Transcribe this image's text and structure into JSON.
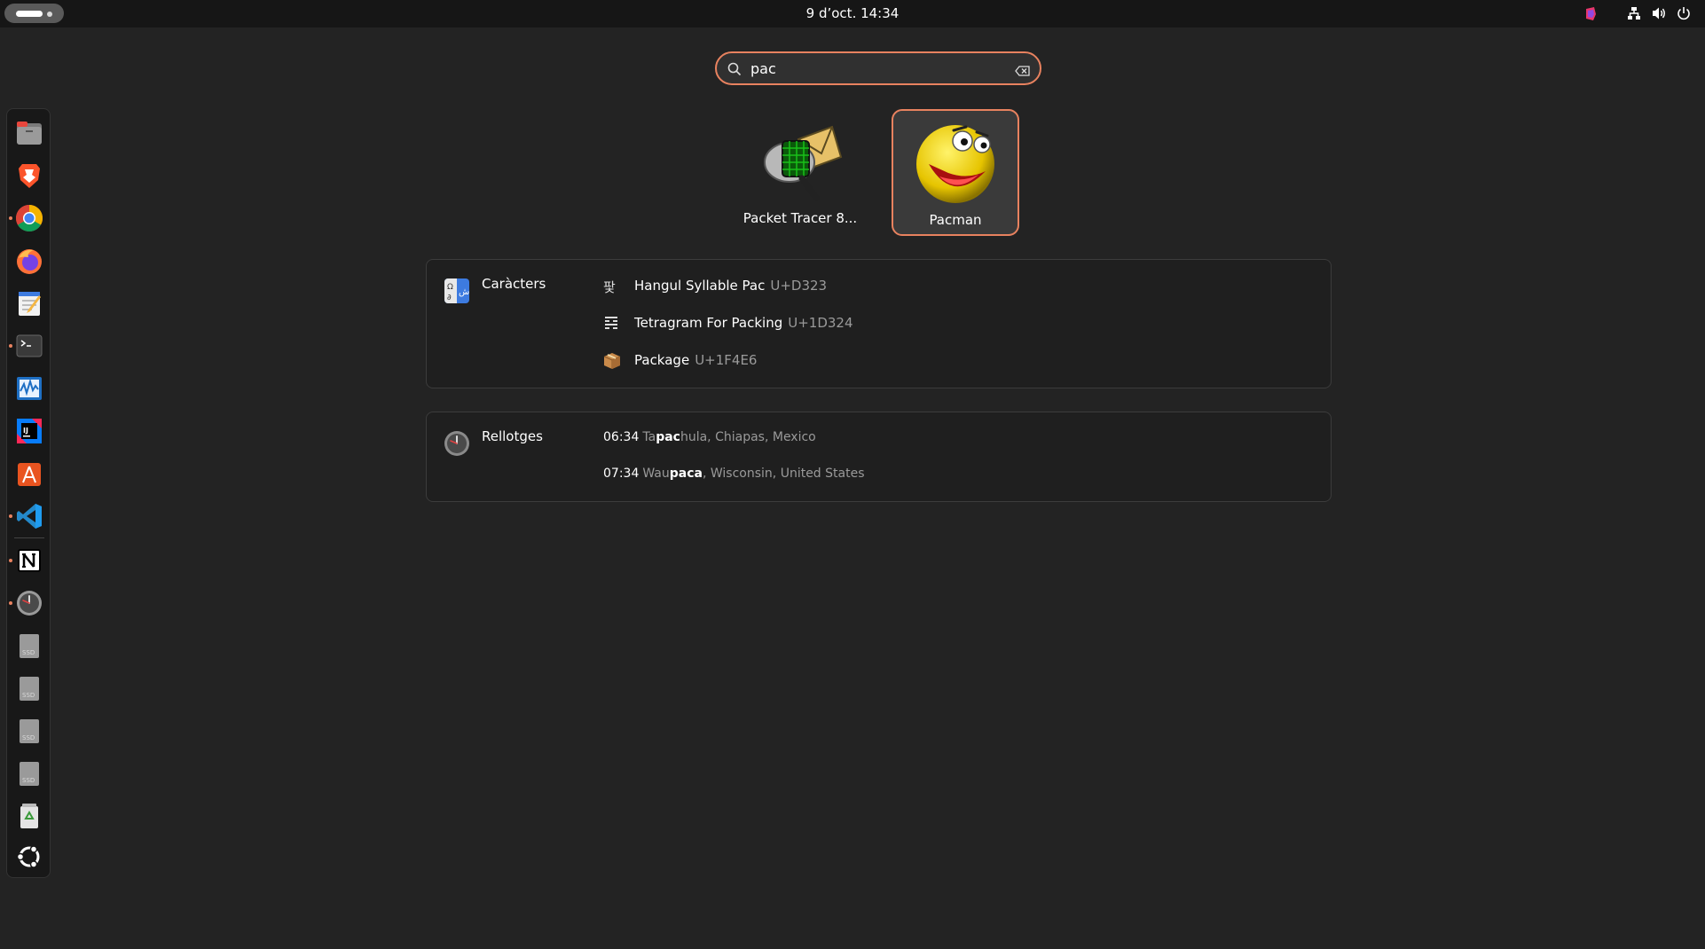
{
  "topbar": {
    "datetime": "9 d’oct.  14:34",
    "tray_icons": [
      "indicator-icon",
      "network-icon",
      "volume-icon",
      "power-icon"
    ]
  },
  "search": {
    "value": "pac"
  },
  "apps": [
    {
      "label": "Packet Tracer 8...",
      "icon": "packet-tracer-icon",
      "selected": false
    },
    {
      "label": "Pacman",
      "icon": "pacman-icon",
      "selected": true
    }
  ],
  "characters": {
    "title": "Caràcters",
    "items": [
      {
        "glyph": "팣",
        "name": "Hangul Syllable Pac",
        "code": "U+D323"
      },
      {
        "glyph": "𝌤",
        "name": "Tetragram For Packing",
        "code": "U+1D324"
      },
      {
        "glyph": "📦",
        "name": "Package",
        "code": "U+1F4E6"
      }
    ]
  },
  "clocks": {
    "title": "Rellotges",
    "items": [
      {
        "time": "06:34",
        "pre": "Ta",
        "match": "pac",
        "post": "hula, Chiapas, Mexico"
      },
      {
        "time": "07:34",
        "pre": "Wau",
        "match": "paca",
        "post": ", Wisconsin, United States"
      }
    ]
  },
  "dock": [
    {
      "name": "files",
      "icon": "files-icon",
      "running": false
    },
    {
      "name": "brave",
      "icon": "brave-icon",
      "running": false
    },
    {
      "name": "chrome",
      "icon": "chrome-icon",
      "running": true
    },
    {
      "name": "firefox",
      "icon": "firefox-icon",
      "running": false
    },
    {
      "name": "text-editor",
      "icon": "text-editor-icon",
      "running": false
    },
    {
      "name": "terminal",
      "icon": "terminal-icon",
      "running": true
    },
    {
      "name": "system-monitor",
      "icon": "system-monitor-icon",
      "running": false
    },
    {
      "name": "intellij",
      "icon": "intellij-icon",
      "running": false
    },
    {
      "name": "app-center",
      "icon": "app-center-icon",
      "running": false
    },
    {
      "name": "vscode",
      "icon": "vscode-icon",
      "running": true
    },
    {
      "name": "notion",
      "icon": "notion-icon",
      "running": true
    },
    {
      "name": "clocks",
      "icon": "clock-icon",
      "running": true
    },
    {
      "name": "ssd-1",
      "icon": "ssd-drive-icon",
      "running": false
    },
    {
      "name": "ssd-2",
      "icon": "ssd-drive-icon",
      "running": false
    },
    {
      "name": "ssd-3",
      "icon": "ssd-drive-icon",
      "running": false
    },
    {
      "name": "ssd-4",
      "icon": "ssd-drive-icon",
      "running": false
    },
    {
      "name": "trash",
      "icon": "trash-icon",
      "running": false
    },
    {
      "name": "show-apps",
      "icon": "ubuntu-logo-icon",
      "running": false
    }
  ],
  "colors": {
    "accent": "#e8825f",
    "background": "#232323",
    "topbar": "#161616"
  }
}
